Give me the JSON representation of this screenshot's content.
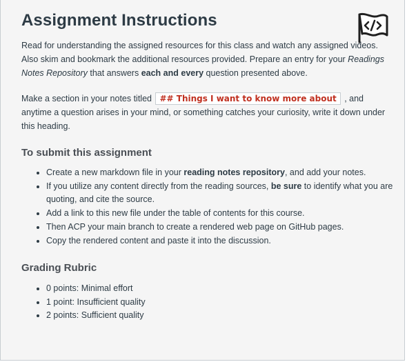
{
  "title": "Assignment Instructions",
  "icon": "code-flag-icon",
  "intro": {
    "part1": "Read for understanding the assigned resources for this class and watch any assigned videos. Also skim and bookmark the additional resources provided. Prepare an entry for your ",
    "italic": "Readings Notes Repository",
    "part2": " that answers ",
    "bold": "each and every",
    "part3": " question presented above."
  },
  "section_note": {
    "before": "Make a section in your notes titled ",
    "code": "## Things I want to know more about",
    "after": " , and anytime a question arises in your mind, or something catches your curiosity, write it down under this heading."
  },
  "submit": {
    "heading": "To submit this assignment",
    "items": [
      {
        "before": "Create a new markdown file in your ",
        "bold": "reading notes repository",
        "after": ", and add your notes."
      },
      {
        "before": "If you utilize any content directly from the reading sources, ",
        "bold": "be sure",
        "after": " to identify what you are quoting, and cite the source."
      },
      {
        "text": "Add a link to this new file under the table of contents for this course."
      },
      {
        "text": "Then ACP your main branch to create a rendered web page on GitHub pages."
      },
      {
        "text": "Copy the rendered content and paste it into the discussion."
      }
    ]
  },
  "rubric": {
    "heading": "Grading Rubric",
    "items": [
      "0 points: Minimal effort",
      "1 point: Insufficient quality",
      "2 points: Sufficient quality"
    ]
  }
}
